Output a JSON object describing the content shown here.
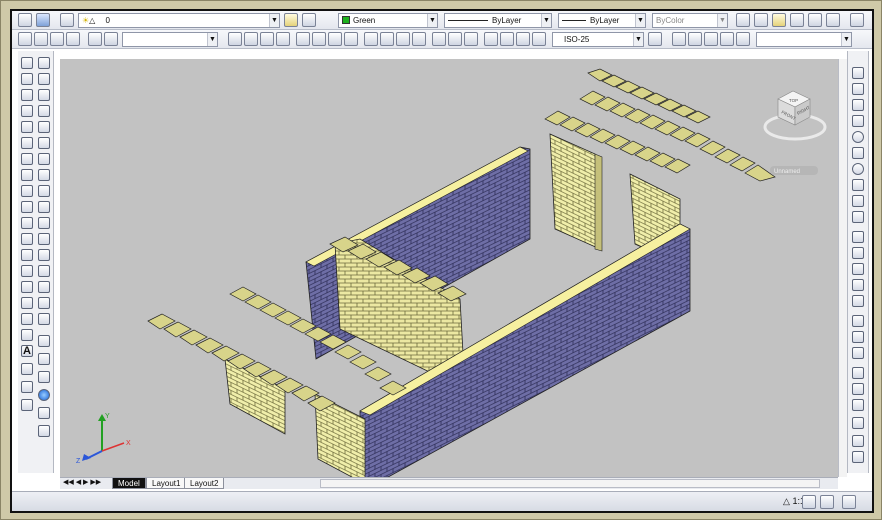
{
  "toolbar1": {
    "layer_value": "0",
    "color_value": "Green",
    "linetype_value": "ByLayer",
    "lineweight_value": "ByLayer",
    "plotstyle_value": "ByColor"
  },
  "toolbar2": {
    "dimstyle_value": "ISO-25"
  },
  "viewcube": {
    "top_label": "TOP",
    "front_label": "FRONT",
    "right_label": "RIGHT",
    "named_view_label": "Unnamed"
  },
  "ucs": {
    "x_label": "X",
    "y_label": "Y",
    "z_label": "Z"
  },
  "tabs": [
    "Model",
    "Layout1",
    "Layout2"
  ],
  "status": {
    "scale": "1:1"
  },
  "colors": {
    "viewport_bg": "#c2c2c2",
    "brick_face_light": "#f0eeaa",
    "brick_face_mid": "#d8d48a",
    "wall_side": "#6e6ea6",
    "wall_top": "#f6f0a0"
  }
}
